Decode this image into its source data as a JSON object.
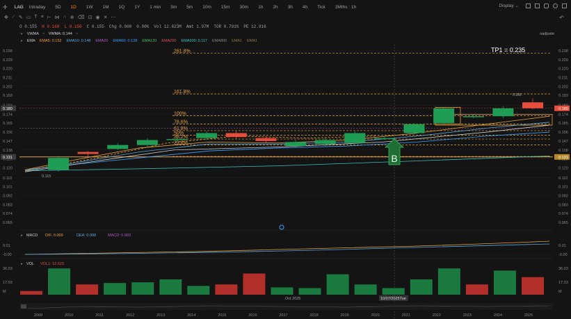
{
  "toolbar": {
    "symbol": "LAG",
    "intervals": [
      "Intraday",
      "5D",
      "1D",
      "1W",
      "1M",
      "1Q",
      "1Y",
      "1 min",
      "3m",
      "5m",
      "10m",
      "15m",
      "30m",
      "1h",
      "2h",
      "3h",
      "4h",
      "Tick",
      "3Mths : 1h"
    ],
    "active_interval": "1D",
    "display_label": "Display"
  },
  "ohlc": {
    "open": "O 0.155",
    "high": "H 0.160",
    "low": "L 0.150",
    "close": "C 0.155",
    "chg": "Chg 0.000",
    "chg_pct": "0.00%",
    "vol": "Vol 12.623M",
    "amt": "Amt 1.97M",
    "tor": "TOR 0.791%",
    "pe": "PE 12.916"
  },
  "user_label": "nadjuste",
  "vwma_legend": {
    "label": "VWMA",
    "vwma": "VWMA: 0.144"
  },
  "ema_legend": {
    "label": "EMA",
    "items": [
      {
        "text": "EMA5: 0.152",
        "color": "#e8a33d"
      },
      {
        "text": "EMA10: 0.148",
        "color": "#5aa7e0"
      },
      {
        "text": "EMA20",
        "color": "#b05acb"
      },
      {
        "text": "EMA60: 0.128",
        "color": "#3fa0ff"
      },
      {
        "text": "EMA120",
        "color": "#4fb868"
      },
      {
        "text": "EMA250",
        "color": "#d05a5a"
      },
      {
        "text": "EMA600: 0.117",
        "color": "#40c0c0"
      },
      {
        "text": "EMA800",
        "color": "#888888"
      },
      {
        "text": "EMA1",
        "color": "#8a7a4a"
      },
      {
        "text": "EMA1",
        "color": "#8a7a4a"
      }
    ]
  },
  "price_axis": [
    "0.238",
    "0.229",
    "0.220",
    "0.211",
    "0.202",
    "0.193",
    "0.183",
    "0.174",
    "0.165",
    "0.156",
    "0.147",
    "0.138",
    "0.129",
    "0.120",
    "0.110",
    "0.101",
    "0.092",
    "0.083",
    "0.074",
    "0.065"
  ],
  "price_tags": {
    "current": "0.180",
    "support": "0.131"
  },
  "fib_levels": [
    {
      "label": "261.8%",
      "price": 0.2355
    },
    {
      "label": "161.8%",
      "price": 0.1945
    },
    {
      "label": "100%",
      "price": 0.1725
    },
    {
      "label": "78.6%",
      "price": 0.164
    },
    {
      "label": "61.8%",
      "price": 0.1575
    },
    {
      "label": "50%",
      "price": 0.153
    },
    {
      "label": "38.2%",
      "price": 0.149
    },
    {
      "label": "23.6%",
      "price": 0.143
    },
    {
      "label": "",
      "price": 0.1315
    }
  ],
  "tp1_label": "TP1 = 0.235",
  "buy_marker": "B",
  "low_label": "0.115",
  "high_label": "0.180",
  "candles": [
    {
      "o": 0.118,
      "c": 0.13,
      "h": 0.132,
      "l": 0.116
    },
    {
      "o": 0.136,
      "c": 0.134,
      "h": 0.137,
      "l": 0.131
    },
    {
      "o": 0.139,
      "c": 0.143,
      "h": 0.145,
      "l": 0.138
    },
    {
      "o": 0.143,
      "c": 0.148,
      "h": 0.15,
      "l": 0.141
    },
    {
      "o": 0.148,
      "c": 0.149,
      "h": 0.151,
      "l": 0.146
    },
    {
      "o": 0.15,
      "c": 0.155,
      "h": 0.157,
      "l": 0.148
    },
    {
      "o": 0.155,
      "c": 0.151,
      "h": 0.157,
      "l": 0.149
    },
    {
      "o": 0.15,
      "c": 0.147,
      "h": 0.152,
      "l": 0.145
    },
    {
      "o": 0.142,
      "c": 0.146,
      "h": 0.148,
      "l": 0.14
    },
    {
      "o": 0.144,
      "c": 0.148,
      "h": 0.15,
      "l": 0.142
    },
    {
      "o": 0.145,
      "c": 0.155,
      "h": 0.157,
      "l": 0.144
    },
    {
      "o": 0.15,
      "c": 0.15,
      "h": 0.152,
      "l": 0.148
    },
    {
      "o": 0.155,
      "c": 0.164,
      "h": 0.165,
      "l": 0.154
    },
    {
      "o": 0.165,
      "c": 0.18,
      "h": 0.181,
      "l": 0.164
    },
    {
      "o": 0.172,
      "c": 0.172,
      "h": 0.174,
      "l": 0.17
    },
    {
      "o": 0.172,
      "c": 0.18,
      "h": 0.182,
      "l": 0.17
    },
    {
      "o": 0.186,
      "c": 0.18,
      "h": 0.19,
      "l": 0.179
    }
  ],
  "macd_legend": {
    "label": "MACD",
    "dif": "DIF: 0.009",
    "dea": "DEA: 0.008",
    "macd": "MACD: 0.003"
  },
  "macd_axis": [
    "0.01",
    "-0.00"
  ],
  "vol_legend": {
    "label": "VOL",
    "vol1": "VOL1: 12.623"
  },
  "vol_axis": [
    "36.03",
    "17.03",
    "M"
  ],
  "volumes": [
    {
      "v": 5,
      "up": false
    },
    {
      "v": 36,
      "up": true
    },
    {
      "v": 14,
      "up": false
    },
    {
      "v": 16,
      "up": true
    },
    {
      "v": 17,
      "up": true
    },
    {
      "v": 21,
      "up": true
    },
    {
      "v": 12,
      "up": true
    },
    {
      "v": 14,
      "up": false
    },
    {
      "v": 29,
      "up": false
    },
    {
      "v": 10,
      "up": true
    },
    {
      "v": 9,
      "up": true
    },
    {
      "v": 28,
      "up": true
    },
    {
      "v": 14,
      "up": true
    },
    {
      "v": 9,
      "up": true
    },
    {
      "v": 21,
      "up": true
    },
    {
      "v": 36,
      "up": true
    },
    {
      "v": 14,
      "up": false
    },
    {
      "v": 33,
      "up": true
    },
    {
      "v": 24,
      "up": false
    }
  ],
  "date_labels": {
    "month": "Oct 2025",
    "cursor": "10/07/2025Tue"
  },
  "year_axis": [
    "2009",
    "2010",
    "2011",
    "2012",
    "2013",
    "2014",
    "2015",
    "2016",
    "2017",
    "2018",
    "2019",
    "2020",
    "2021",
    "2022",
    "2023",
    "2024",
    "2025"
  ],
  "colors": {
    "up": "#1f9d55",
    "down": "#e84c3d",
    "fib": "#e8a33d",
    "bg": "#141414"
  }
}
